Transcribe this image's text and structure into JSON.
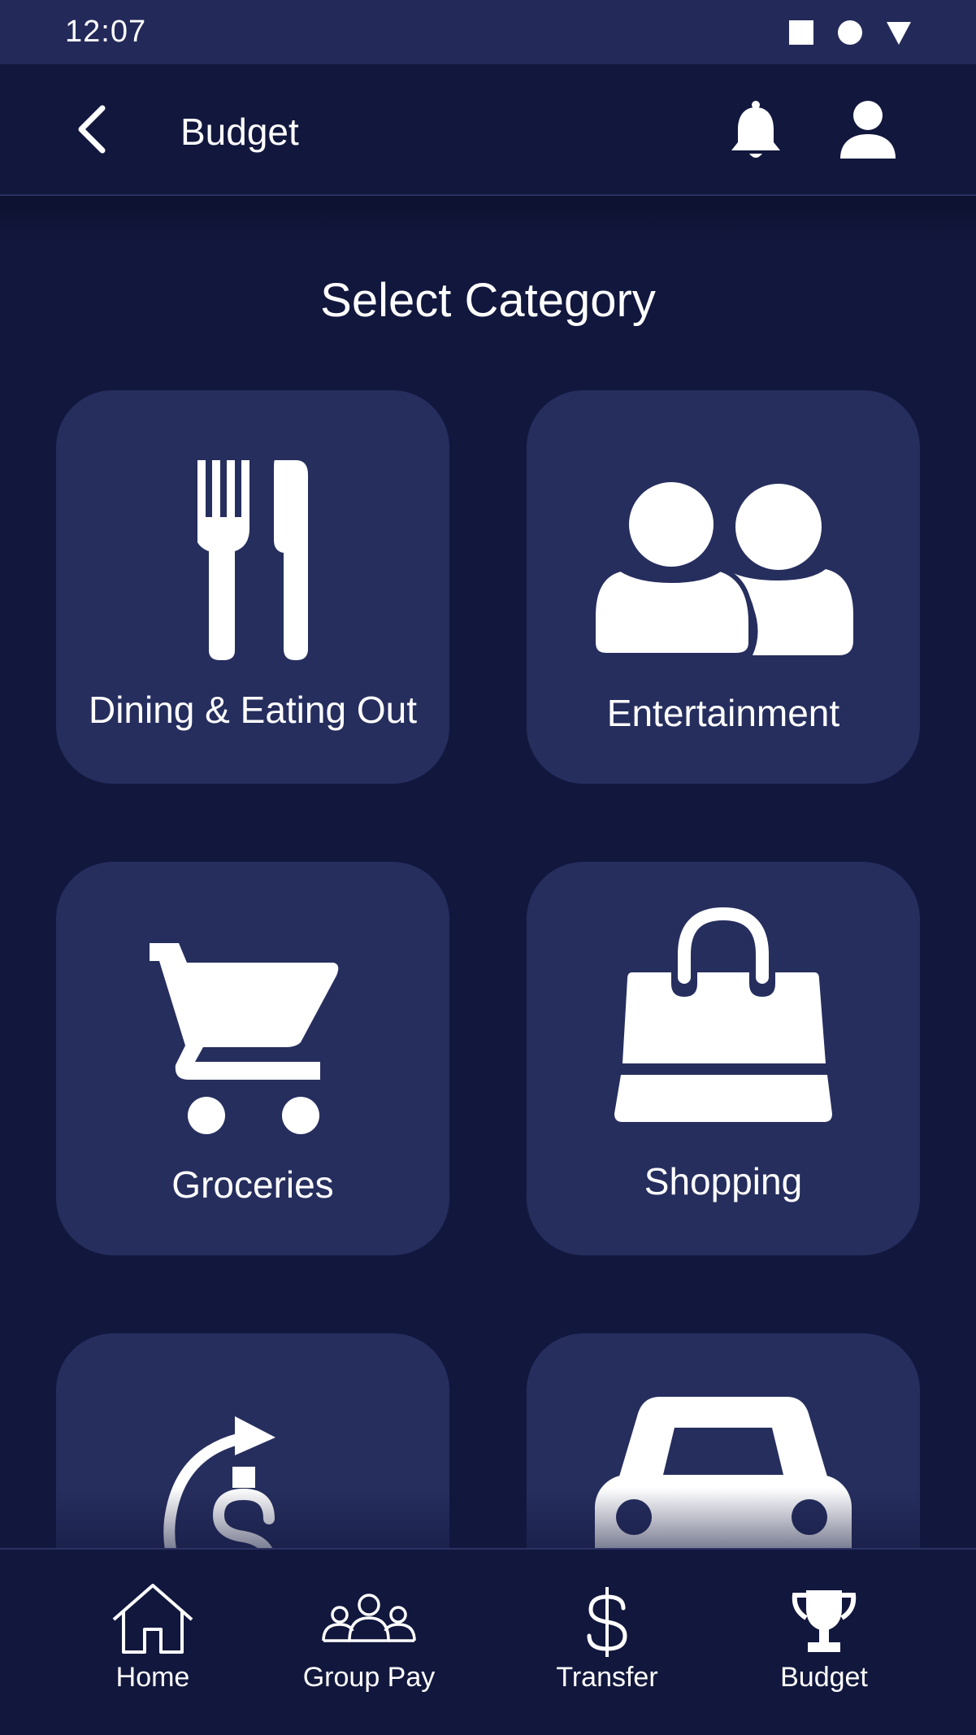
{
  "status_bar": {
    "time": "12:07",
    "icons": [
      "stop-square-icon",
      "record-circle-icon",
      "signal-triangle-icon"
    ]
  },
  "app_bar": {
    "title": "Budget",
    "icons": [
      "back-chevron-icon",
      "bell-icon",
      "user-icon"
    ]
  },
  "section": {
    "title": "Select Category"
  },
  "categories": [
    {
      "label": "Dining & Eating Out",
      "icon": "fork-knife-icon"
    },
    {
      "label": "Entertainment",
      "icon": "people-icon"
    },
    {
      "label": "Groceries",
      "icon": "shopping-cart-icon"
    },
    {
      "label": "Shopping",
      "icon": "shopping-bag-icon"
    },
    {
      "label": "",
      "icon": "recurring-dollar-icon"
    },
    {
      "label": "",
      "icon": "car-icon"
    }
  ],
  "bottom_nav": {
    "active": "Budget",
    "items": [
      {
        "label": "Home",
        "icon": "home-icon"
      },
      {
        "label": "Group Pay",
        "icon": "group-icon"
      },
      {
        "label": "Transfer",
        "icon": "dollar-icon"
      },
      {
        "label": "Budget",
        "icon": "trophy-icon"
      }
    ]
  },
  "colors": {
    "background": "#12173d",
    "tile": "#262e5e",
    "status_bar": "#232a59",
    "text": "#ffffff"
  }
}
